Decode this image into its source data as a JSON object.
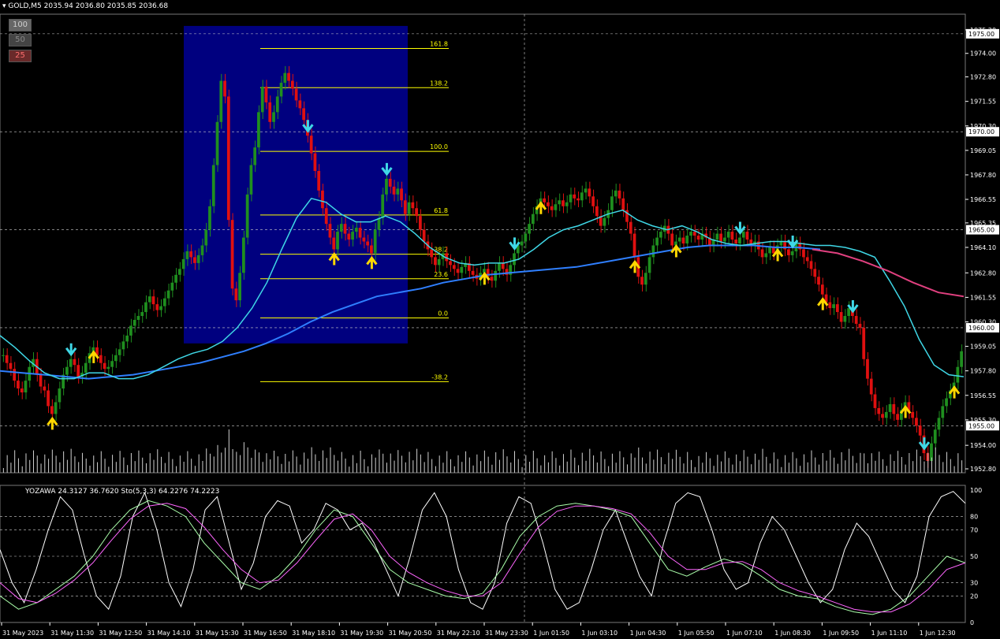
{
  "header": {
    "symbol": "GOLD,M5",
    "ohlc": "2035.94 2036.80 2035.85 2036.68"
  },
  "buttons": [
    {
      "label": "100",
      "bg": "#666666",
      "fg": "#cfcfcf"
    },
    {
      "label": "50",
      "bg": "#444444",
      "fg": "#8a8a8a"
    },
    {
      "label": "25",
      "bg": "#6a2a2a",
      "fg": "#ff7070"
    }
  ],
  "subwindow_header": "YOZAWA 24.3127 36.7620  Sto(5,3,3) 64.2276 74.2223",
  "colors": {
    "bull": "#1f8f1f",
    "bear": "#e01010",
    "fib_box": "#00007f",
    "fib_line": "#ffff00",
    "ma_fast": "#3fd7e6",
    "ma_slow": "#2f7fff",
    "ma_pink": "#e0407f",
    "up_arrow": "#ffd700",
    "down_arrow": "#3fd7e6",
    "grid": "#cfcfcf",
    "axis_text": "#ffffff"
  },
  "chart_data": [
    {
      "type": "candlestick",
      "title": "GOLD,M5",
      "ylim": [
        1952.6,
        1976.0
      ],
      "y_ticks": [
        "1975.20",
        "1974.00",
        "1972.80",
        "1971.55",
        "1970.30",
        "1969.05",
        "1967.80",
        "1966.55",
        "1965.35",
        "1964.10",
        "1962.80",
        "1961.55",
        "1960.30",
        "1959.05",
        "1957.80",
        "1956.55",
        "1955.30",
        "1954.00",
        "1952.80"
      ],
      "price_tags": [
        "1975.00",
        "1970.00",
        "1965.00",
        "1960.00",
        "1955.00"
      ],
      "x_labels": [
        "31 May 2023",
        "31 May 11:30",
        "31 May 12:50",
        "31 May 14:10",
        "31 May 15:30",
        "31 May 16:50",
        "31 May 18:10",
        "31 May 19:30",
        "31 May 20:50",
        "31 May 22:10",
        "31 May 23:30",
        "1 Jun 01:50",
        "1 Jun 03:10",
        "1 Jun 04:30",
        "1 Jun 05:50",
        "1 Jun 07:10",
        "1 Jun 08:30",
        "1 Jun 09:50",
        "1 Jun 11:10",
        "1 Jun 12:30"
      ],
      "fib_levels": [
        {
          "label": "161.8",
          "price": 1974.25
        },
        {
          "label": "138.2",
          "price": 1972.25
        },
        {
          "label": "100.0",
          "price": 1969.0
        },
        {
          "label": "61.8",
          "price": 1965.75
        },
        {
          "label": "38.2",
          "price": 1963.75
        },
        {
          "label": "23.6",
          "price": 1962.5
        },
        {
          "label": "0.0",
          "price": 1960.5
        },
        {
          "label": "-38.2",
          "price": 1957.25
        }
      ],
      "close_series": [
        1958.6,
        1958.2,
        1957.9,
        1957.3,
        1956.9,
        1956.7,
        1957.3,
        1958.0,
        1958.4,
        1957.6,
        1957.0,
        1956.8,
        1956.0,
        1955.6,
        1956.2,
        1956.9,
        1957.6,
        1958.0,
        1958.4,
        1958.1,
        1957.5,
        1957.7,
        1958.2,
        1958.7,
        1959.0,
        1958.6,
        1958.2,
        1957.9,
        1958.0,
        1958.3,
        1958.6,
        1958.9,
        1959.3,
        1959.6,
        1960.1,
        1960.4,
        1960.6,
        1960.8,
        1961.3,
        1961.6,
        1961.2,
        1960.9,
        1961.1,
        1961.5,
        1961.9,
        1962.3,
        1962.7,
        1963.0,
        1963.5,
        1963.9,
        1963.6,
        1963.3,
        1963.7,
        1964.2,
        1965.0,
        1966.2,
        1968.3,
        1970.5,
        1972.6,
        1971.8,
        1965.5,
        1962.0,
        1961.4,
        1962.8,
        1964.6,
        1966.8,
        1968.3,
        1969.2,
        1971.0,
        1972.3,
        1971.5,
        1970.5,
        1971.0,
        1971.8,
        1972.5,
        1973.0,
        1972.6,
        1972.2,
        1971.6,
        1971.2,
        1970.6,
        1969.8,
        1968.9,
        1968.0,
        1967.0,
        1966.1,
        1965.3,
        1964.6,
        1964.0,
        1964.9,
        1965.3,
        1964.8,
        1964.5,
        1964.9,
        1965.1,
        1964.6,
        1964.4,
        1964.2,
        1963.8,
        1965.0,
        1965.6,
        1966.8,
        1967.6,
        1967.2,
        1966.8,
        1967.1,
        1966.5,
        1965.8,
        1966.4,
        1966.1,
        1965.7,
        1965.0,
        1964.4,
        1964.0,
        1963.6,
        1963.2,
        1963.5,
        1963.8,
        1963.4,
        1963.2,
        1963.0,
        1962.8,
        1963.1,
        1963.3,
        1962.9,
        1962.7,
        1962.5,
        1962.8,
        1963.0,
        1962.6,
        1962.4,
        1962.9,
        1963.3,
        1963.0,
        1962.7,
        1963.2,
        1963.8,
        1964.2,
        1964.4,
        1964.8,
        1965.3,
        1965.8,
        1966.2,
        1966.6,
        1966.4,
        1966.2,
        1966.0,
        1966.3,
        1966.5,
        1966.2,
        1966.4,
        1966.8,
        1966.6,
        1966.5,
        1966.9,
        1967.1,
        1966.7,
        1966.2,
        1965.7,
        1965.2,
        1965.6,
        1966.0,
        1966.7,
        1967.0,
        1966.6,
        1966.0,
        1965.4,
        1964.8,
        1963.6,
        1962.6,
        1962.2,
        1962.8,
        1963.6,
        1964.2,
        1964.6,
        1964.9,
        1965.2,
        1964.8,
        1964.2,
        1964.4,
        1964.6,
        1964.3,
        1964.7,
        1964.9,
        1964.7,
        1964.5,
        1964.8,
        1964.6,
        1964.2,
        1964.5,
        1964.8,
        1964.4,
        1964.6,
        1964.9,
        1964.5,
        1964.3,
        1964.6,
        1964.9,
        1964.5,
        1964.2,
        1964.4,
        1964.0,
        1963.6,
        1963.8,
        1964.1,
        1963.8,
        1964.2,
        1964.4,
        1964.0,
        1963.7,
        1963.9,
        1964.3,
        1964.0,
        1963.6,
        1963.4,
        1963.0,
        1962.6,
        1962.2,
        1961.7,
        1961.3,
        1961.0,
        1961.2,
        1960.8,
        1960.3,
        1960.6,
        1961.0,
        1960.6,
        1960.2,
        1960.0,
        1958.4,
        1957.4,
        1956.6,
        1955.9,
        1955.6,
        1955.4,
        1955.7,
        1956.1,
        1955.6,
        1955.3,
        1955.8,
        1956.2,
        1955.7,
        1955.4,
        1955.0,
        1954.5,
        1953.6,
        1953.2,
        1954.1,
        1954.8,
        1955.4,
        1956.0,
        1956.4,
        1956.8,
        1957.2,
        1958.0,
        1958.8
      ],
      "ma_fast_series": [
        1959.6,
        1959.0,
        1958.3,
        1957.7,
        1957.4,
        1957.4,
        1957.7,
        1957.7,
        1957.4,
        1957.4,
        1957.6,
        1958.0,
        1958.4,
        1958.7,
        1958.9,
        1959.3,
        1960.0,
        1961.0,
        1962.3,
        1964.0,
        1965.6,
        1966.6,
        1966.4,
        1965.8,
        1965.4,
        1965.4,
        1965.7,
        1965.4,
        1964.8,
        1964.1,
        1963.6,
        1963.3,
        1963.2,
        1963.3,
        1963.3,
        1963.5,
        1964.0,
        1964.6,
        1965.0,
        1965.2,
        1965.5,
        1965.8,
        1966.0,
        1965.5,
        1965.2,
        1965.0,
        1965.2,
        1964.9,
        1964.5,
        1964.3,
        1964.2,
        1964.3,
        1964.4,
        1964.4,
        1964.3,
        1964.2,
        1964.2,
        1964.1,
        1963.9,
        1963.6,
        1962.4,
        1961.1,
        1959.4,
        1958.1,
        1957.6,
        1957.5
      ],
      "ma_slow_series": [
        1957.8,
        1957.7,
        1957.6,
        1957.5,
        1957.4,
        1957.5,
        1957.6,
        1957.8,
        1958.0,
        1958.2,
        1958.5,
        1958.8,
        1959.2,
        1959.7,
        1960.3,
        1960.8,
        1961.2,
        1961.6,
        1961.8,
        1962.0,
        1962.3,
        1962.5,
        1962.7,
        1962.8,
        1962.9,
        1963.0,
        1963.1,
        1963.3,
        1963.5,
        1963.7,
        1963.9,
        1964.1,
        1964.2,
        1964.2,
        1964.2,
        1964.1,
        1964.1,
        1964.0
      ],
      "ma_pink_series": [
        1964.0,
        1963.8,
        1963.4,
        1962.9,
        1962.3,
        1961.8,
        1961.6
      ],
      "buy_arrows": [
        13,
        24,
        88,
        98,
        128,
        143,
        168,
        179,
        206,
        218,
        240,
        253,
        270
      ],
      "sell_arrows": [
        18,
        81,
        102,
        136,
        196,
        210,
        226,
        245,
        281
      ]
    },
    {
      "type": "line",
      "title": "YOZAWA / Sto(5,3,3)",
      "ylim": [
        0,
        100
      ],
      "y_ticks": [
        "100",
        "80",
        "70",
        "50",
        "30",
        "20",
        "0"
      ],
      "series": [
        {
          "name": "YOZAWA",
          "color": "#ffffff",
          "values": [
            55,
            30,
            15,
            40,
            70,
            95,
            85,
            50,
            20,
            10,
            35,
            80,
            98,
            70,
            30,
            12,
            40,
            85,
            95,
            60,
            25,
            45,
            80,
            92,
            88,
            60,
            70,
            90,
            85,
            70,
            75,
            60,
            40,
            20,
            50,
            85,
            98,
            80,
            40,
            15,
            10,
            30,
            75,
            95,
            90,
            60,
            25,
            10,
            15,
            40,
            70,
            85,
            60,
            35,
            20,
            60,
            90,
            98,
            95,
            70,
            40,
            25,
            30,
            60,
            80,
            70,
            50,
            30,
            15,
            25,
            55,
            75,
            65,
            45,
            25,
            15,
            35,
            80,
            95,
            99,
            90
          ]
        },
        {
          "name": "Sto-main",
          "color": "#aaffaa",
          "values": [
            20,
            10,
            15,
            25,
            35,
            50,
            70,
            85,
            92,
            88,
            80,
            60,
            45,
            30,
            25,
            35,
            50,
            70,
            85,
            80,
            60,
            40,
            30,
            25,
            20,
            18,
            22,
            40,
            65,
            80,
            88,
            90,
            88,
            85,
            80,
            60,
            40,
            35,
            42,
            48,
            44,
            35,
            25,
            20,
            18,
            12,
            8,
            6,
            10,
            20,
            35,
            50,
            45
          ]
        },
        {
          "name": "Sto-signal",
          "color": "#ff66ff",
          "values": [
            30,
            18,
            15,
            22,
            32,
            45,
            62,
            78,
            88,
            90,
            86,
            72,
            55,
            40,
            30,
            32,
            45,
            62,
            78,
            82,
            70,
            50,
            38,
            30,
            24,
            20,
            20,
            30,
            52,
            72,
            84,
            88,
            88,
            86,
            82,
            68,
            50,
            40,
            40,
            45,
            46,
            40,
            30,
            24,
            20,
            15,
            10,
            8,
            8,
            14,
            25,
            40,
            45
          ]
        }
      ],
      "levels": [
        80,
        70,
        50,
        30,
        20
      ]
    }
  ]
}
